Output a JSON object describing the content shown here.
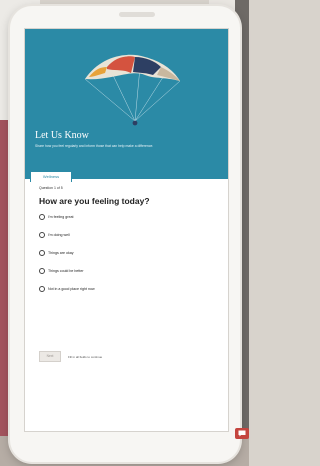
{
  "header": {
    "title": "Let Us Know",
    "subtitle": "Share how you feel regularly and inform those that can help make a difference."
  },
  "tab": {
    "label": "Wellness"
  },
  "survey": {
    "question_count": "Question 1 of 5",
    "question": "How are you feeling today?",
    "options": [
      "I'm feeling great",
      "I'm doing well",
      "Things are okay",
      "Things could be better",
      "Not in a good place right now"
    ],
    "next_label": "Next",
    "hint": "Fill in all fields to continue"
  },
  "colors": {
    "banner": "#2b8aa6",
    "chat_button": "#c4453f",
    "background_accent": "#a3545e"
  },
  "icons": {
    "chat": "chat-bubble-icon"
  }
}
